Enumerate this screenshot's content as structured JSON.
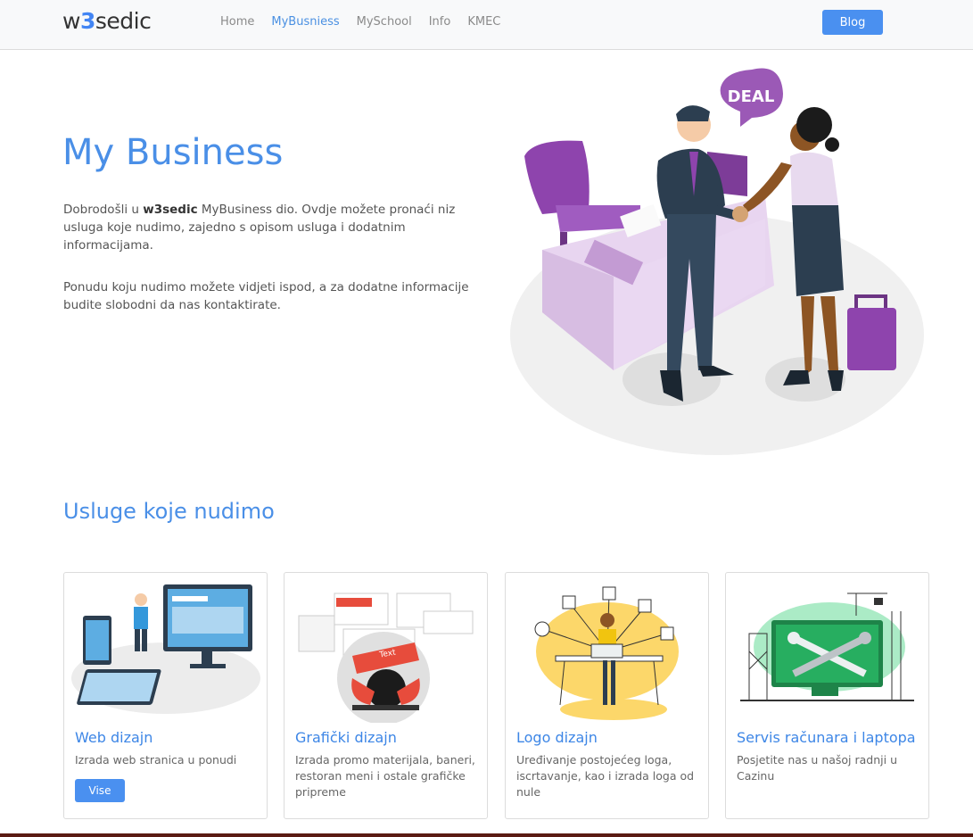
{
  "nav": {
    "brand_pre": "w",
    "brand_num": "3",
    "brand_post": "sedic",
    "links": [
      "Home",
      "MyBusniess",
      "MySchool",
      "Info",
      "KMEC"
    ],
    "active_index": 1,
    "blog_label": "Blog"
  },
  "hero": {
    "title": "My Business",
    "intro_pre": "Dobrodošli u ",
    "intro_brand": "w3sedic",
    "intro_post": " MyBusiness dio. Ovdje možete pronaći niz usluga koje nudimo, zajedno s opisom usluga i dodatnim informacijama.",
    "intro2": "Ponudu koju nudimo možete vidjeti ispod, a za dodatne informacije budite slobodni da nas kontaktirate.",
    "bubble_text": "DEAL"
  },
  "services": {
    "title": "Usluge koje nudimo",
    "cards": [
      {
        "title": "Web dizajn",
        "desc": "Izrada web stranica u ponudi",
        "button": "Vise"
      },
      {
        "title": "Grafički dizajn",
        "desc": "Izrada promo materijala, baneri, restoran meni i ostale grafičke pripreme"
      },
      {
        "title": "Logo dizajn",
        "desc": "Uređivanje postojećeg loga, iscrtavanje, kao i izrada loga od nule"
      },
      {
        "title": "Servis računara i laptopa",
        "desc": "Posjetite nas u našoj radnji u Cazinu"
      }
    ]
  },
  "colors": {
    "accent": "#4a8fe7",
    "button": "#4a90f0",
    "purple": "#9b59b6"
  }
}
